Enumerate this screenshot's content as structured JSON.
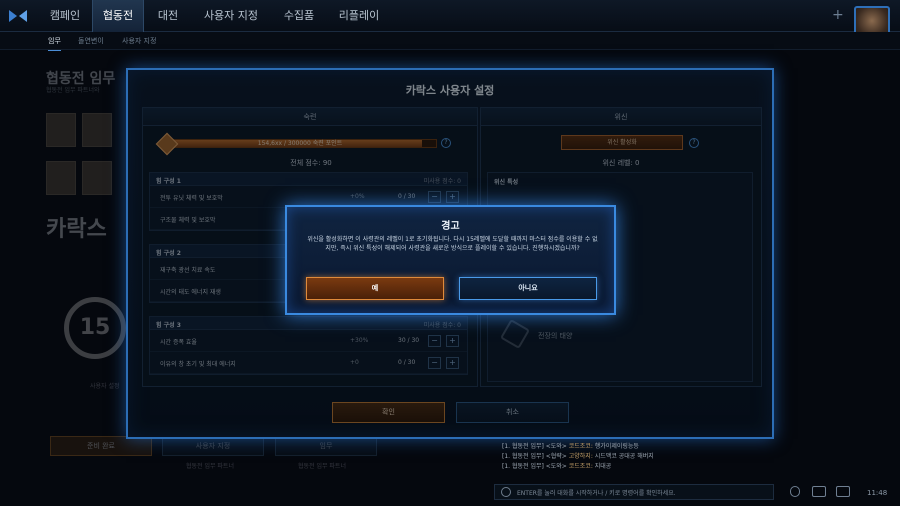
{
  "nav": {
    "tabs": [
      "캠페인",
      "협동전",
      "대전",
      "사용자 지정",
      "수집품",
      "리플레이"
    ],
    "active_index": 1,
    "plus": "+"
  },
  "subnav": {
    "tabs": [
      "임무",
      "돌연변이",
      "사용자 지정"
    ],
    "active_index": 0
  },
  "background": {
    "title": "협동전 임무",
    "subtitle": "협동전 임무 파트너와",
    "hero_name": "카락스",
    "level": "15",
    "ready_button": "준비 완료",
    "small_labels": [
      "사용자 설정",
      "사용자 지정",
      "임무",
      "협동전 임무 파트너",
      "협동전 임무 파트너"
    ]
  },
  "dialog": {
    "title": "카락스 사용자 설정",
    "left_panel": {
      "header": "숙련",
      "level_badge": "15",
      "xp_text": "154,6xx / 300000 숙련 포인트",
      "xp_fraction": 0.95,
      "total_points_label": "전체 점수: 90",
      "groups": [
        {
          "title": "힘 구성 1",
          "points": "미사용 점수: 0",
          "rows": [
            {
              "name": "전투 유닛 체력 및 보호막",
              "pct": "+0%",
              "count": "0 / 30"
            },
            {
              "name": "구조물 체력 및 보호막",
              "pct": "",
              "count": ""
            }
          ]
        },
        {
          "title": "힘 구성 2",
          "points": "",
          "rows": [
            {
              "name": "재구축 광선 치료 속도",
              "pct": "",
              "count": ""
            },
            {
              "name": "시간의 태도 에너지 재생",
              "pct": "",
              "count": ""
            }
          ]
        },
        {
          "title": "힘 구성 3",
          "points": "미사용 점수: 0",
          "rows": [
            {
              "name": "시간 증폭 효율",
              "pct": "+30%",
              "count": "30 / 30"
            },
            {
              "name": "이유의 창 초기 및 최대 에너지",
              "pct": "+0",
              "count": "0 / 30"
            }
          ]
        }
      ]
    },
    "right_panel": {
      "header": "위신",
      "activate_button": "위신 활성화",
      "prestige_level": "위신 레벨: 0",
      "traits_title": "위신 특성",
      "trait_label": "전장의 태양"
    },
    "confirm_label": "확인",
    "cancel_label": "취소"
  },
  "warning": {
    "title": "경고",
    "message": "위신을 활성화하면 이 사령관의 레벨이 1로 초기화됩니다. 다시 15레벨에 도달할 때까지 마스터 점수를 이용할 수 없지만, 즉시 위신 특성이 해제되어 사령관을 새로운 방식으로 플레이할 수 있습니다. 진행하시겠습니까?",
    "yes_label": "예",
    "no_label": "아니요"
  },
  "chat": {
    "lines": [
      {
        "prefix": "[1. 협동전 임무] <도와>",
        "name": "코드조코: ",
        "text": "행가이제이링능등"
      },
      {
        "prefix": "[1. 협동전 임무] <협략>",
        "name": "고양하지: ",
        "text": "시드맥코 공대공 해버지"
      },
      {
        "prefix": "[1. 협동전 임무] <도와>",
        "name": "코드조코: ",
        "text": "지대공"
      }
    ],
    "placeholder": "ENTER를 눌러 대화를 시작하거나 / 키로 명령어를 확인하세요.",
    "clock": "11:48"
  },
  "colors": {
    "accent_blue": "#3a8ae0",
    "accent_orange": "#e08a3a"
  },
  "icons": [
    "sc2-logo-icon",
    "plus-icon",
    "avatar",
    "help-icon",
    "hex-icon",
    "chat-icon",
    "microphone-icon",
    "social-icon",
    "screen-icon"
  ]
}
